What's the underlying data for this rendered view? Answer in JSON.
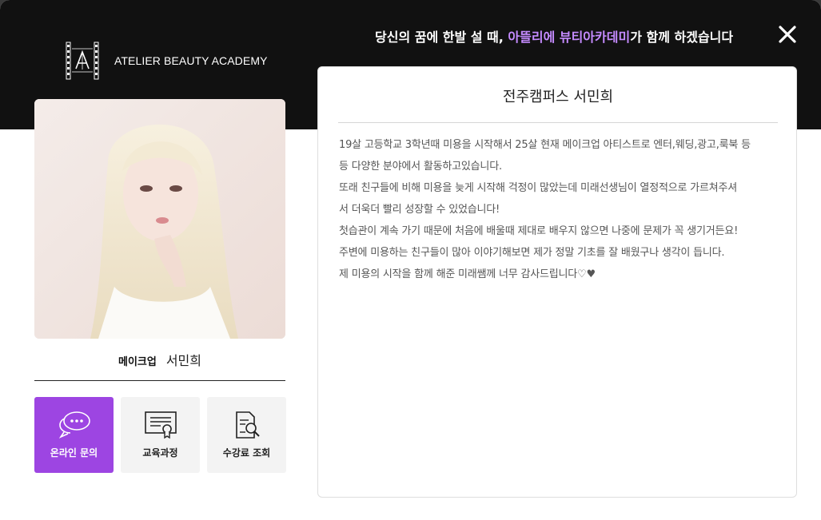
{
  "header": {
    "brand_name": "ATELIER BEAUTY ACADEMY",
    "logo_mark_text": "MAKE-UP A ATELIER",
    "headline_pre": "당신의 꿈에 한발 설 때, ",
    "headline_accent": "아뜰리에 뷰티아카데미",
    "headline_post": "가 함께 하겠습니다",
    "close_icon": "close-icon"
  },
  "profile": {
    "category": "메이크업",
    "name": "서민희"
  },
  "actions": [
    {
      "label": "온라인 문의",
      "icon": "chat-bubbles-icon"
    },
    {
      "label": "교육과정",
      "icon": "certificate-icon"
    },
    {
      "label": "수강료 조회",
      "icon": "document-search-icon"
    }
  ],
  "review": {
    "title": "전주캠퍼스 서민희",
    "lines": [
      "19살 고등학교 3학년때 미용을 시작해서 25살 현재 메이크업 아티스트로 엔터,웨딩,광고,룩북 등",
      "등 다양한 분야에서 활동하고있습니다.",
      "또래 친구들에 비해 미용을 늦게 시작해 걱정이 많았는데 미래선생님이 열정적으로 가르쳐주셔",
      "서 더욱더 빨리 성장할 수 있었습니다!",
      "첫습관이 계속 가기 때문에 처음에 배울때 제대로 배우지 않으면 나중에 문제가 꼭 생기거든요!",
      "주변에 미용하는 친구들이 많아 이야기해보면 제가 정말 기초를 잘 배웠구나 생각이 듭니다.",
      "제 미용의 시작을 함께 해준 미래쌤께 너무 감사드립니다♡♥"
    ]
  },
  "colors": {
    "accent": "#9d45e2",
    "headline_accent": "#c58bff",
    "dark_band": "#111111"
  }
}
